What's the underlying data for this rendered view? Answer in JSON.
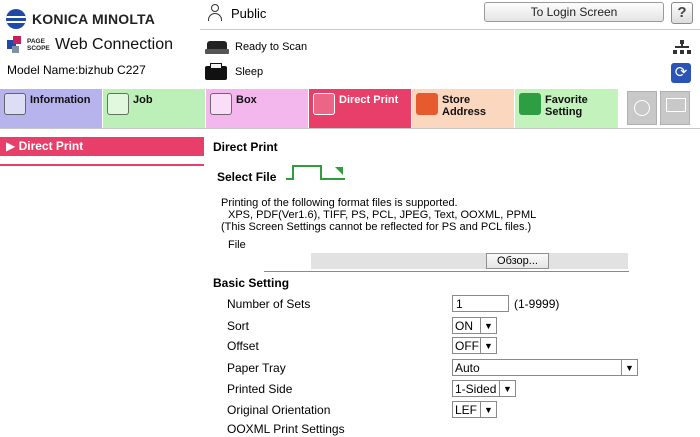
{
  "brand": {
    "company": "KONICA MINOLTA",
    "pagescope": "PAGE SCOPE",
    "product": "Web Connection",
    "model": "Model Name:bizhub C227"
  },
  "header": {
    "user": "Public",
    "login_button": "To Login Screen",
    "help": "?",
    "status_scan": "Ready to Scan",
    "status_sleep": "Sleep"
  },
  "tabs": [
    {
      "id": "information",
      "label": "Information",
      "color": "#b7b3ec",
      "active": false
    },
    {
      "id": "job",
      "label": "Job",
      "color": "#bdf0b8",
      "active": false
    },
    {
      "id": "box",
      "label": "Box",
      "color": "#f3b7ee",
      "active": false
    },
    {
      "id": "direct-print",
      "label": "Direct Print",
      "color": "#e83f6a",
      "active": true
    },
    {
      "id": "store-address",
      "label": "Store\nAddress",
      "color": "#fbd7c0",
      "active": false
    },
    {
      "id": "favorite-setting",
      "label": "Favorite\nSetting",
      "color": "#c3f2bd",
      "active": false
    }
  ],
  "sidebar": {
    "items": [
      {
        "label": "▶ Direct Print"
      }
    ]
  },
  "main": {
    "title": "Direct Print",
    "select_file": "Select File",
    "info_line1": "Printing of the following format files is supported.",
    "info_line2": "XPS, PDF(Ver1.6), TIFF, PS, PCL, JPEG, Text, OOXML, PPML",
    "info_line3": "(This Screen Settings cannot be reflected for PS and PCL files.)",
    "file_label": "File",
    "browse": "Обзор...",
    "basic_setting": "Basic Setting",
    "settings": {
      "sets_label": "Number of Sets",
      "sets_value": "1",
      "sets_range": "(1-9999)",
      "sort_label": "Sort",
      "sort_value": "ON",
      "offset_label": "Offset",
      "offset_value": "OFF",
      "tray_label": "Paper Tray",
      "tray_value": "Auto",
      "side_label": "Printed Side",
      "side_value": "1-Sided",
      "orient_label": "Original Orientation",
      "orient_value": "LEF",
      "ooxml_label": "OOXML Print Settings"
    }
  }
}
